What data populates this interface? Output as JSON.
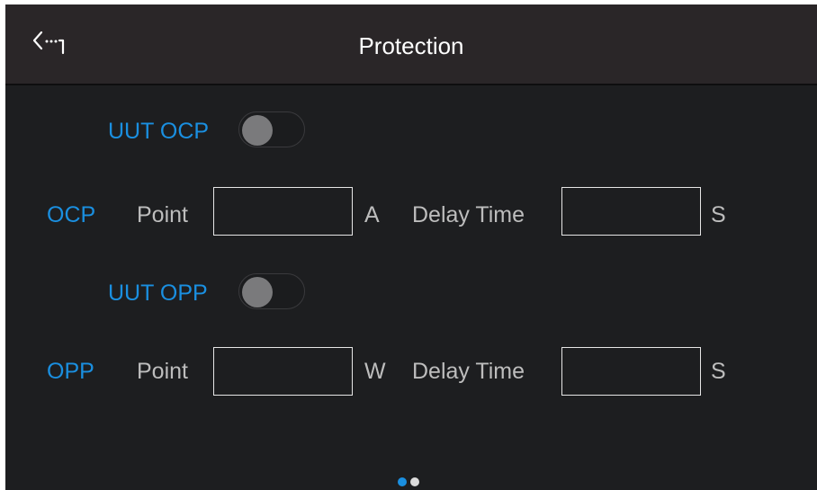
{
  "header": {
    "title": "Protection",
    "back_icon": "back-arrow-icon"
  },
  "uut_ocp": {
    "label": "UUT OCP",
    "enabled": false
  },
  "ocp_row": {
    "prefix": "OCP",
    "point_label": "Point",
    "point_value": "",
    "point_unit": "A",
    "delay_label": "Delay Time",
    "delay_value": "",
    "delay_unit": "S"
  },
  "uut_opp": {
    "label": "UUT OPP",
    "enabled": false
  },
  "opp_row": {
    "prefix": "OPP",
    "point_label": "Point",
    "point_value": "",
    "point_unit": "W",
    "delay_label": "Delay Time",
    "delay_value": "",
    "delay_unit": "S"
  },
  "pagination": {
    "current_page": 1,
    "total_pages": 2
  },
  "colors": {
    "accent": "#1a8fe0",
    "background": "#1d1e20",
    "header": "#2a2628",
    "text_secondary": "#bdbdbd",
    "toggle_knob_off": "#7a7a7c"
  }
}
